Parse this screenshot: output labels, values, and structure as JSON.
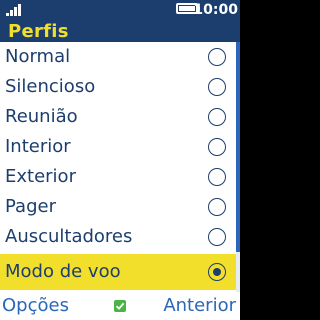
{
  "status": {
    "time": "10:00",
    "signal_bars": 4,
    "battery_level": 1.0,
    "signal_icon": "signal-strength-icon",
    "battery_icon": "battery-icon"
  },
  "header": {
    "title": "Perfis"
  },
  "profiles": [
    {
      "label": "Normal",
      "selected": false
    },
    {
      "label": "Silencioso",
      "selected": false
    },
    {
      "label": "Reunião",
      "selected": false
    },
    {
      "label": "Interior",
      "selected": false
    },
    {
      "label": "Exterior",
      "selected": false
    },
    {
      "label": "Pager",
      "selected": false
    },
    {
      "label": "Auscultadores",
      "selected": false
    },
    {
      "label": "Modo de voo",
      "selected": true
    }
  ],
  "softkeys": {
    "left": "Opções",
    "center_icon": "ok-check-icon",
    "right": "Anterior"
  },
  "colors": {
    "header_bg": "#1c3e6e",
    "title_yellow": "#f2df2c",
    "highlight": "#f2df2c",
    "text": "#1c3e6e",
    "softkey_text": "#2b66b8",
    "ok_green": "#4cb348"
  }
}
